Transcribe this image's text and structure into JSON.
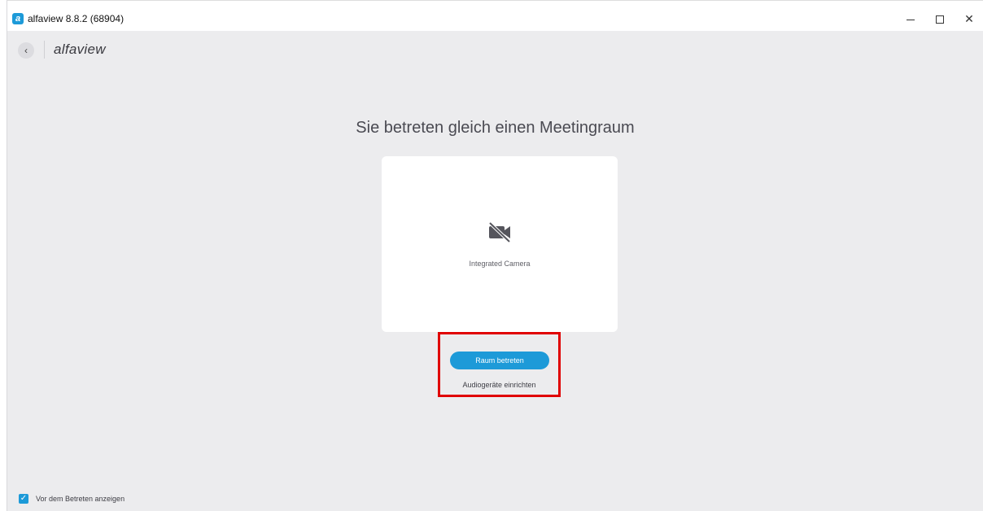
{
  "window": {
    "title": "alfaview 8.8.2 (68904)",
    "app_icon_letter": "a",
    "controls": {
      "minimize": "minimize-icon",
      "maximize": "maximize-icon",
      "close": "close-icon",
      "close_glyph": "✕"
    }
  },
  "header": {
    "back_glyph": "‹",
    "brand": "alfaview"
  },
  "main": {
    "heading": "Sie betreten gleich einen Meetingraum",
    "camera": {
      "icon": "camera-off-icon",
      "label": "Integrated Camera"
    },
    "join_button": "Raum betreten",
    "audio_link": "Audiogeräte einrichten"
  },
  "footer": {
    "checkbox_checked": true,
    "checkbox_glyph": "✓",
    "checkbox_label": "Vor dem Betreten anzeigen"
  },
  "colors": {
    "accent": "#1d9ad8",
    "background": "#ececee",
    "highlight": "#e00000",
    "card": "#ffffff"
  }
}
